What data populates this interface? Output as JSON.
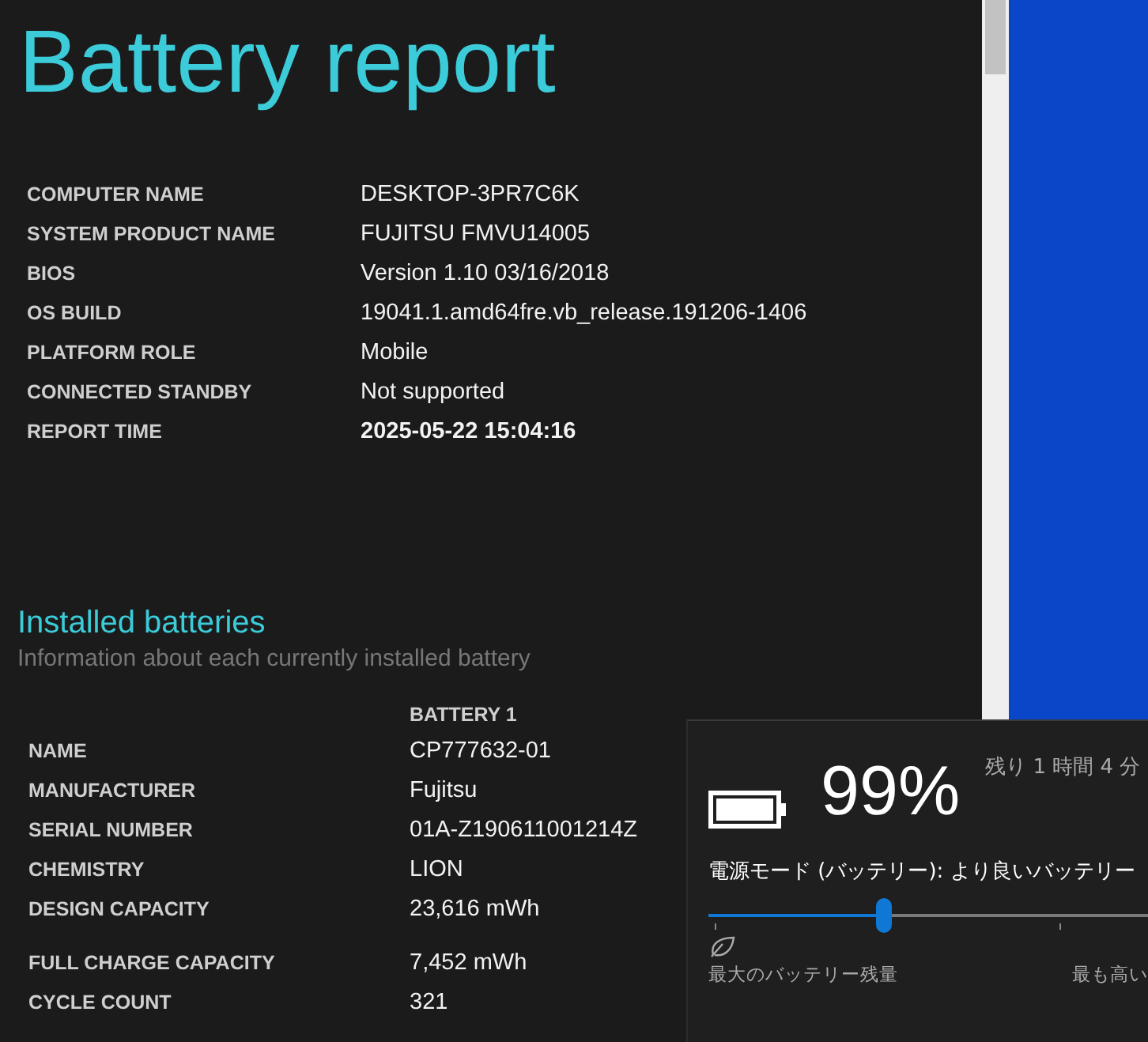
{
  "report": {
    "title": "Battery report",
    "system_info": [
      {
        "label": "COMPUTER NAME",
        "value": "DESKTOP-3PR7C6K"
      },
      {
        "label": "SYSTEM PRODUCT NAME",
        "value": "FUJITSU FMVU14005"
      },
      {
        "label": "BIOS",
        "value": "Version 1.10 03/16/2018"
      },
      {
        "label": "OS BUILD",
        "value": "19041.1.amd64fre.vb_release.191206-1406"
      },
      {
        "label": "PLATFORM ROLE",
        "value": "Mobile"
      },
      {
        "label": "CONNECTED STANDBY",
        "value": "Not supported"
      },
      {
        "label": "REPORT TIME",
        "value": "2025-05-22  15:04:16"
      }
    ],
    "installed_batteries": {
      "heading": "Installed batteries",
      "subtitle": "Information about each currently installed battery",
      "column": "BATTERY 1",
      "rows": [
        {
          "label": "NAME",
          "value": "CP777632-01"
        },
        {
          "label": "MANUFACTURER",
          "value": "Fujitsu"
        },
        {
          "label": "SERIAL NUMBER",
          "value": "01A-Z190611001214Z"
        },
        {
          "label": "CHEMISTRY",
          "value": "LION"
        },
        {
          "label": "DESIGN CAPACITY",
          "value": "23,616 mWh"
        },
        {
          "label": "FULL CHARGE CAPACITY",
          "value": "7,452 mWh"
        },
        {
          "label": "CYCLE COUNT",
          "value": "321"
        }
      ]
    }
  },
  "battery_flyout": {
    "percent": "99%",
    "remaining": "残り 1 時間 4 分",
    "power_mode_label": "電源モード (バッテリー): より良いバッテリー",
    "power_slider": {
      "level": 0.4
    },
    "left_label": "最大のバッテリー残量",
    "right_label": "最も高い"
  }
}
